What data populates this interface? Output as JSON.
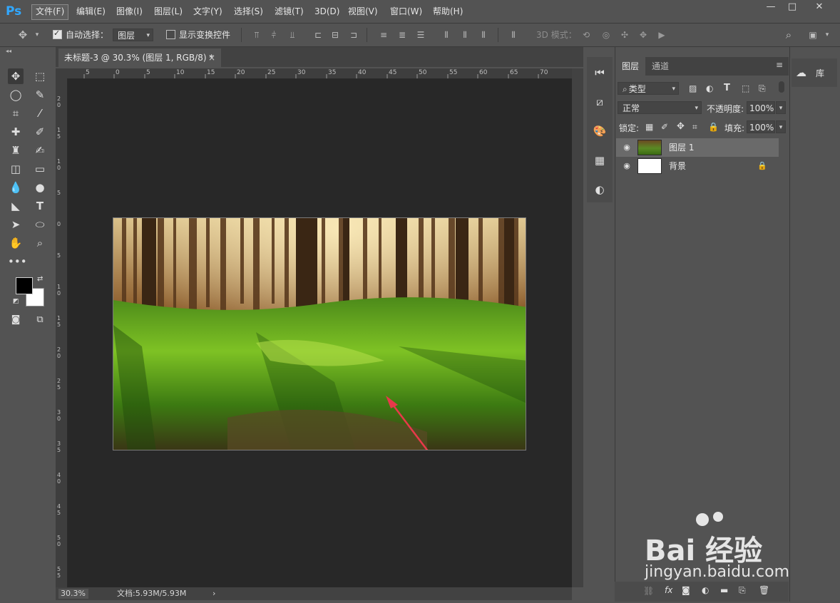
{
  "app": {
    "logo": "Ps"
  },
  "menu": [
    {
      "label": "文件(F)",
      "active": true
    },
    {
      "label": "编辑(E)"
    },
    {
      "label": "图像(I)"
    },
    {
      "label": "图层(L)"
    },
    {
      "label": "文字(Y)"
    },
    {
      "label": "选择(S)"
    },
    {
      "label": "滤镜(T)"
    },
    {
      "label": "3D(D)"
    },
    {
      "label": "视图(V)"
    },
    {
      "label": "窗口(W)"
    },
    {
      "label": "帮助(H)"
    }
  ],
  "window_controls": {
    "minimize": "—",
    "maximize": "□",
    "close": "✕"
  },
  "options": {
    "auto_select_label": "自动选择：",
    "auto_select_checked": true,
    "auto_select_target": "图层",
    "show_transform_label": "显示变换控件",
    "show_transform_checked": false,
    "mode_3d_label": "3D 模式："
  },
  "document": {
    "tab_title": "未标题-3 @ 30.3% (图层 1, RGB/8) *",
    "close": "×",
    "zoom": "30.3%",
    "doc_size": "文档:5.93M/5.93M",
    "status_arrow": "›",
    "ruler_h": [
      "5",
      "0",
      "5",
      "10",
      "15",
      "20",
      "25",
      "30",
      "35",
      "40",
      "45",
      "50",
      "55",
      "60",
      "65",
      "70"
    ],
    "ruler_v": [
      "2\n0",
      "1\n5",
      "1\n0",
      "5",
      "0",
      "5",
      "1\n0",
      "1\n5",
      "2\n0",
      "2\n5",
      "3\n0",
      "3\n5",
      "4\n0",
      "4\n5",
      "5\n0",
      "5\n5"
    ]
  },
  "panels": {
    "tabs": [
      "图层",
      "通道"
    ],
    "filter_kind": "类型",
    "blend_mode": "正常",
    "opacity_label": "不透明度:",
    "opacity_value": "100%",
    "lock_label": "锁定:",
    "fill_label": "填充:",
    "fill_value": "100%",
    "layers": [
      {
        "name": "图层 1",
        "active": true,
        "locked": false
      },
      {
        "name": "背景",
        "active": false,
        "locked": true
      }
    ],
    "library_label": "库"
  },
  "watermark": {
    "brand": "Bai 经验",
    "url": "jingyan.baidu.com"
  },
  "colors": {
    "accent": "#31a8ff",
    "annotation_arrow": "#e8394a"
  }
}
